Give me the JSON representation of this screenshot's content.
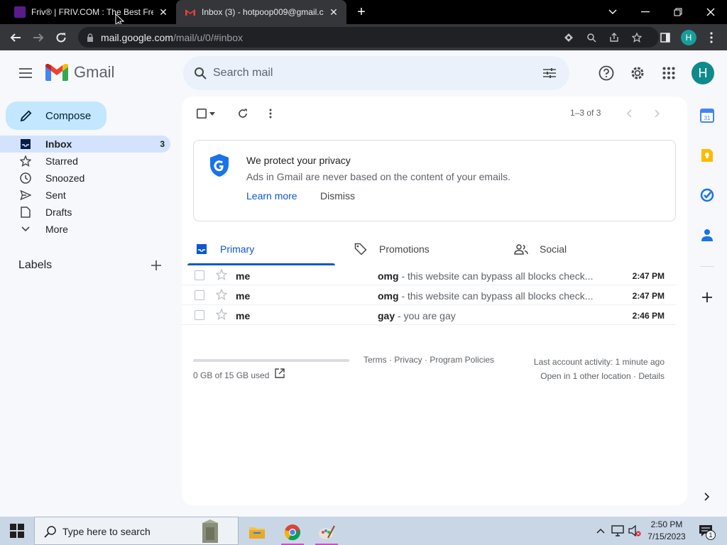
{
  "browser": {
    "tabs": [
      {
        "title": "Friv® | FRIV.COM : The Best Free",
        "active": false
      },
      {
        "title": "Inbox (3) - hotpoop009@gmail.c",
        "active": true
      }
    ],
    "url": {
      "host": "mail.google.com",
      "path": "/mail/u/0/#inbox"
    },
    "profile_initial": "H"
  },
  "gmail": {
    "brand": "Gmail",
    "search_placeholder": "Search mail",
    "account_initial": "H",
    "compose_label": "Compose",
    "nav": [
      {
        "label": "Inbox",
        "count": "3",
        "icon": "inbox-icon",
        "active": true
      },
      {
        "label": "Starred",
        "count": "",
        "icon": "star-icon",
        "active": false
      },
      {
        "label": "Snoozed",
        "count": "",
        "icon": "clock-icon",
        "active": false
      },
      {
        "label": "Sent",
        "count": "",
        "icon": "send-icon",
        "active": false
      },
      {
        "label": "Drafts",
        "count": "",
        "icon": "draft-icon",
        "active": false
      },
      {
        "label": "More",
        "count": "",
        "icon": "chevron-down-icon",
        "active": false
      }
    ],
    "labels_heading": "Labels",
    "pager": "1–3 of 3",
    "privacy": {
      "title": "We protect your privacy",
      "body": "Ads in Gmail are never based on the content of your emails.",
      "learn_more": "Learn more",
      "dismiss": "Dismiss"
    },
    "tabs": [
      {
        "label": "Primary",
        "icon": "inbox-icon",
        "active": true
      },
      {
        "label": "Promotions",
        "icon": "tag-icon",
        "active": false
      },
      {
        "label": "Social",
        "icon": "people-icon",
        "active": false
      }
    ],
    "emails": [
      {
        "sender": "me",
        "subject": "omg",
        "snippet": " - this website can bypass all blocks check...",
        "time": "2:47 PM"
      },
      {
        "sender": "me",
        "subject": "omg",
        "snippet": " - this website can bypass all blocks check...",
        "time": "2:47 PM"
      },
      {
        "sender": "me",
        "subject": "gay",
        "snippet": " - you are gay",
        "time": "2:46 PM"
      }
    ],
    "footer": {
      "storage": "0 GB of 15 GB used",
      "links": "Terms · Privacy · Program Policies",
      "activity": "Last account activity: 1 minute ago",
      "other_location": "Open in 1 other location · Details"
    }
  },
  "taskbar": {
    "search_placeholder": "Type here to search",
    "time": "2:50 PM",
    "date": "7/15/2023",
    "notification_count": "1"
  },
  "colors": {
    "gmail_bg": "#f6f8fc",
    "compose": "#c2e7ff",
    "active_nav": "#d3e3fd",
    "primary_blue": "#0b57d0"
  }
}
